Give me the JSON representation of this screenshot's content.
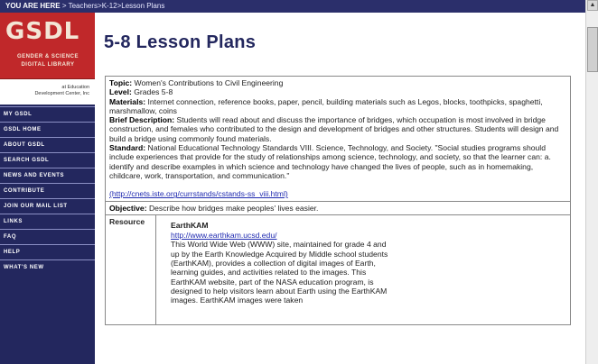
{
  "breadcrumb": {
    "prefix": "YOU ARE HERE",
    "path": " > Teachers>K-12>Lesson Plans"
  },
  "logo": {
    "letters": "GSDL",
    "line1": "GENDER & SCIENCE",
    "line2": "DIGITAL LIBRARY",
    "org_line1": "at Education",
    "org_line2": "Development Center, Inc"
  },
  "nav": [
    {
      "label": "MY GSDL"
    },
    {
      "label": "GSDL HOME"
    },
    {
      "label": "ABOUT GSDL"
    },
    {
      "label": "SEARCH GSDL"
    },
    {
      "label": "NEWS AND EVENTS"
    },
    {
      "label": "CONTRIBUTE"
    },
    {
      "label": "JOIN OUR MAIL LIST"
    },
    {
      "label": "LINKS"
    },
    {
      "label": "FAQ"
    },
    {
      "label": "HELP"
    },
    {
      "label": "WHAT'S NEW"
    }
  ],
  "page_title": "5-8 Lesson Plans",
  "lesson": {
    "topic_label": "Topic:",
    "topic": " Women's Contributions to Civil Engineering",
    "level_label": "Level:",
    "level": " Grades 5-8",
    "materials_label": "Materials:",
    "materials": " Internet connection, reference books, paper, pencil, building materials such as Legos, blocks, toothpicks, spaghetti, marshmallow, coins",
    "brief_label": "Brief Description:",
    "brief": " Students will read about and discuss the importance of bridges, which occupation is most involved in bridge construction, and females who contributed to the design and development of bridges and other structures. Students will design and build a bridge using commonly found materials.",
    "standard_label": "Standard:",
    "standard": " National Educational Technology Standards VIII. Science, Technology, and Society. \"Social studies programs should include experiences that provide for the study of relationships among science, technology, and society, so that the learner can: a. identify and describe examples in which science and technology have changed the lives of people, such as in homemaking, childcare, work, transportation, and communication.\"",
    "standard_link": "(http://cnets.iste.org/currstands/cstands-ss_viii.html)",
    "objective_label": "Objective:",
    "objective": " Describe how bridges make peoples' lives easier.",
    "resource_label": "Resource",
    "resource_title": "EarthKAM",
    "resource_link": "http://www.earthkam.ucsd.edu/",
    "resource_desc": "This World Wide Web (WWW) site, maintained for grade 4 and up by the Earth Knowledge Acquired by Middle school students (EarthKAM), provides a collection of digital images of Earth, learning guides, and activities related to the images. This EarthKAM website, part of the NASA education program, is designed to help visitors learn about Earth using the EarthKAM images. EarthKAM images were taken"
  },
  "colors": {
    "nav_bg": "#23275e",
    "logo_bg": "#c0282a",
    "link": "#1f2ab0"
  }
}
